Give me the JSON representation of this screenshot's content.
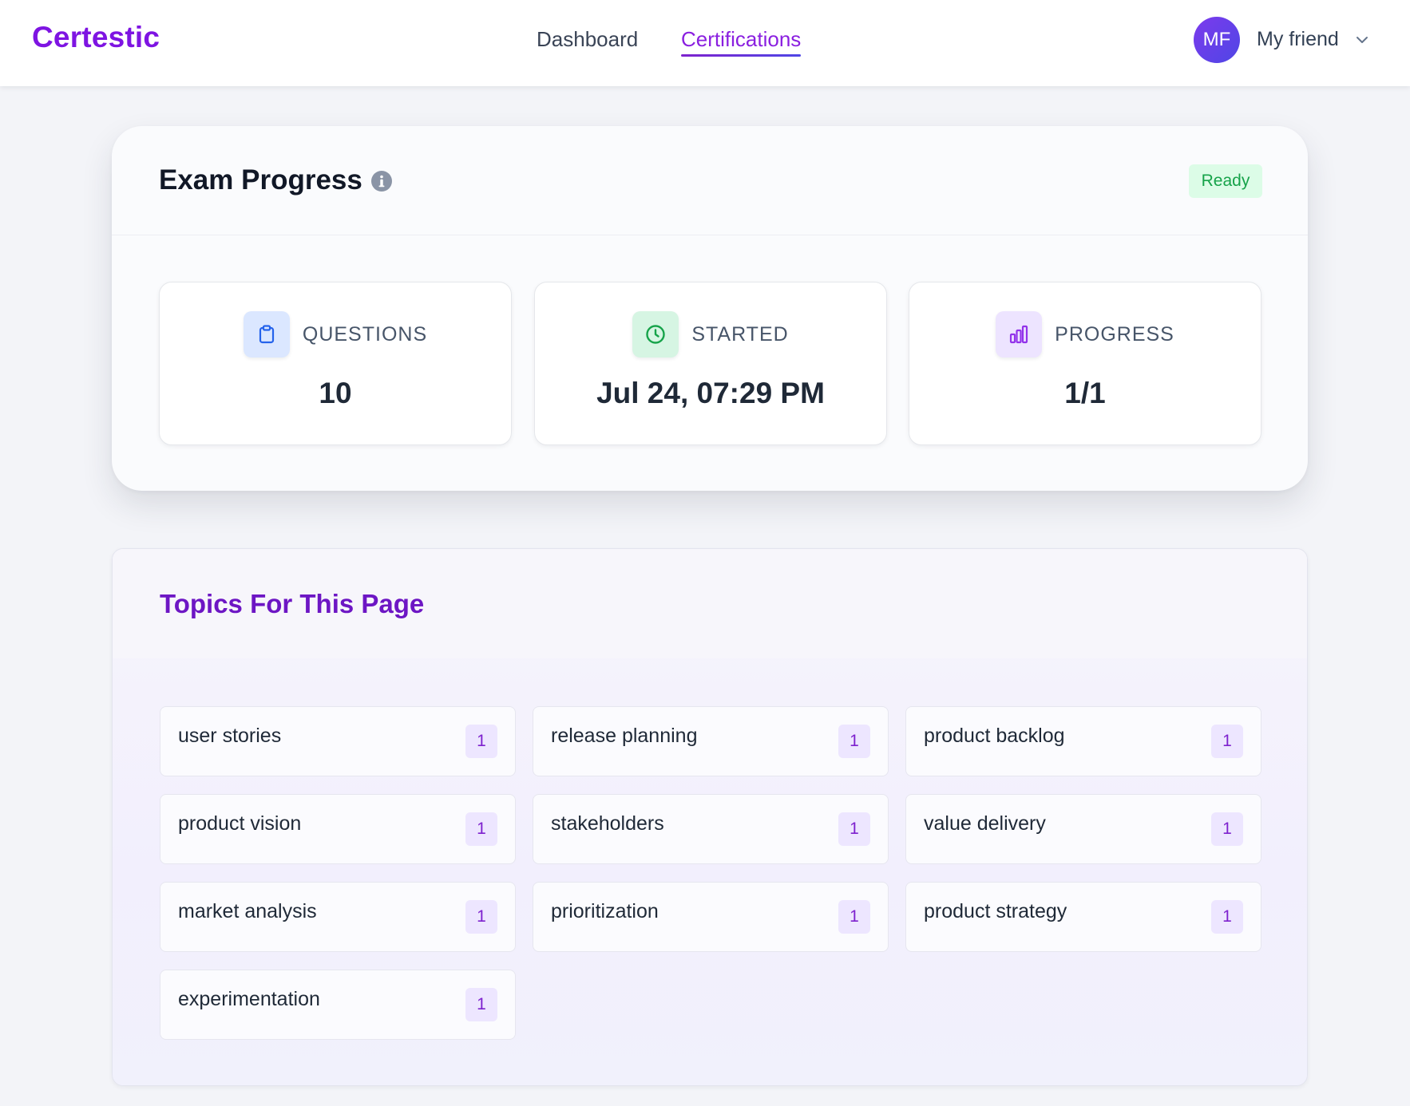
{
  "header": {
    "logo": "Certestic",
    "nav": [
      {
        "label": "Dashboard",
        "active": false
      },
      {
        "label": "Certifications",
        "active": true
      }
    ],
    "user": {
      "initials": "MF",
      "name": "My friend"
    }
  },
  "exam_progress": {
    "title": "Exam Progress",
    "status": "Ready",
    "stats": [
      {
        "label": "QUESTIONS",
        "value": "10",
        "icon": "clipboard-icon"
      },
      {
        "label": "STARTED",
        "value": "Jul 24, 07:29 PM",
        "icon": "clock-icon"
      },
      {
        "label": "PROGRESS",
        "value": "1/1",
        "icon": "bar-chart-icon"
      }
    ]
  },
  "topics": {
    "title": "Topics For This Page",
    "items": [
      {
        "name": "user stories",
        "count": "1"
      },
      {
        "name": "release planning",
        "count": "1"
      },
      {
        "name": "product backlog",
        "count": "1"
      },
      {
        "name": "product vision",
        "count": "1"
      },
      {
        "name": "stakeholders",
        "count": "1"
      },
      {
        "name": "value delivery",
        "count": "1"
      },
      {
        "name": "market analysis",
        "count": "1"
      },
      {
        "name": "prioritization",
        "count": "1"
      },
      {
        "name": "product strategy",
        "count": "1"
      },
      {
        "name": "experimentation",
        "count": "1"
      }
    ]
  },
  "colors": {
    "brand": "#7e14e2",
    "ready_bg": "#dcfce7",
    "ready_text": "#16a34a"
  }
}
